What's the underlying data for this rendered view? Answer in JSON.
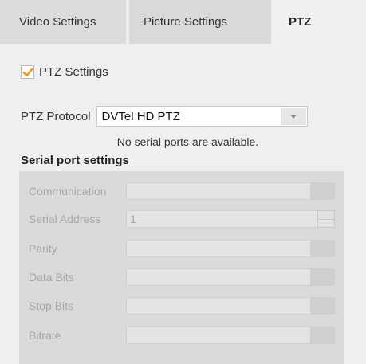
{
  "tabs": [
    {
      "label": "Video Settings"
    },
    {
      "label": "Picture Settings"
    },
    {
      "label": "PTZ"
    }
  ],
  "ptz_settings": {
    "label": "PTZ Settings",
    "checked": true
  },
  "ptz_protocol": {
    "label": "PTZ Protocol",
    "value": "DVTel HD PTZ"
  },
  "status_message": "No serial ports are available.",
  "serial": {
    "title": "Serial port settings",
    "fields": [
      {
        "label": "Communication",
        "value": ""
      },
      {
        "label": "Serial Address",
        "value": "1"
      },
      {
        "label": "Parity",
        "value": ""
      },
      {
        "label": "Data Bits",
        "value": ""
      },
      {
        "label": "Stop Bits",
        "value": ""
      },
      {
        "label": "Bitrate",
        "value": ""
      }
    ]
  },
  "colors": {
    "accent": "#f39c12",
    "active_tab_bg": "#efefef"
  }
}
